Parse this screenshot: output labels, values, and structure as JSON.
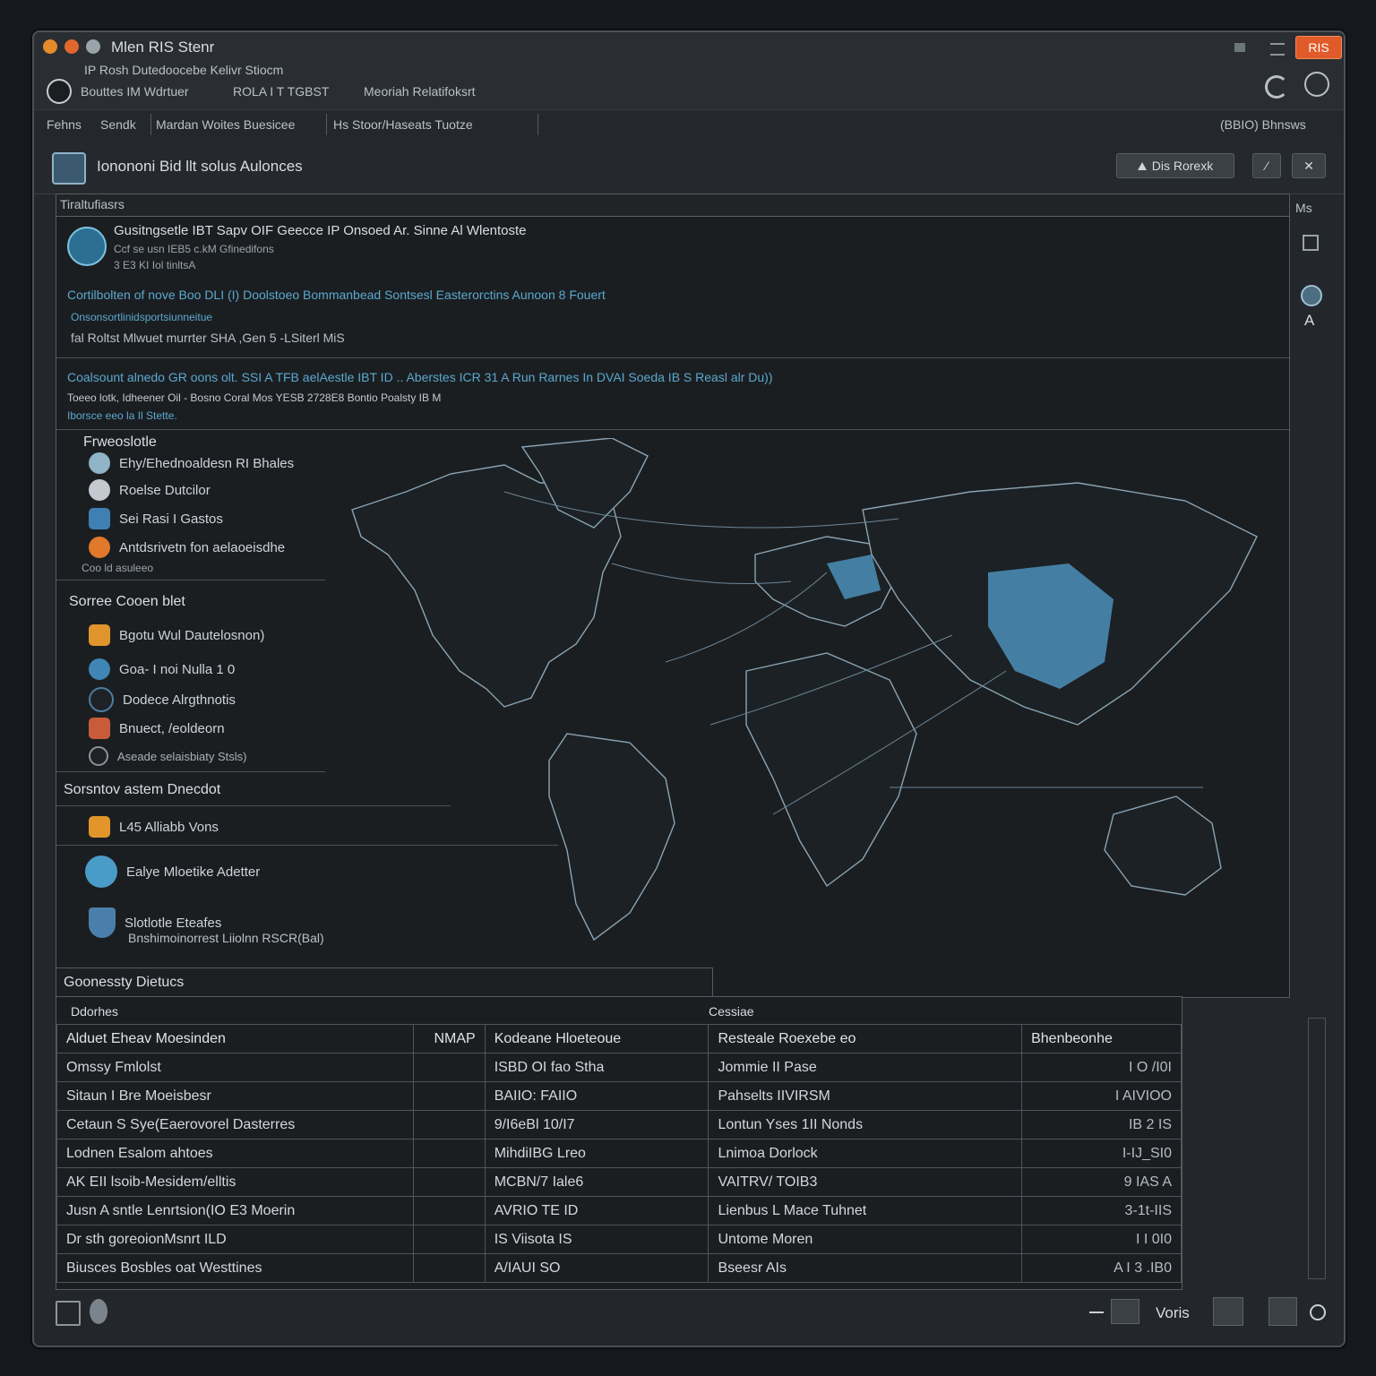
{
  "window": {
    "title": "Mlen RIS Stenr",
    "tray_badge": "RIS",
    "subtitle": "IP Rosh Dutedoocebe Kelivr Stiocm",
    "info_line": "Bouttes IM Wdrtuer",
    "info_mid": "ROLA I T TGBST",
    "info_right": "Meoriah Relatifoksrt"
  },
  "menubar": {
    "items": [
      "Fehns",
      "Sendk",
      "Mardan Woites Buesicee",
      "Hs Stoor/Haseats Tuotze"
    ],
    "right": "(BBIO) Bhnsws"
  },
  "toolbar": {
    "title": "Ionononi Bid llt solus Aulonces",
    "button_primary": "Dis Rorexk",
    "icon_left": "chart-icon",
    "icon_right": "expand-icon"
  },
  "right_rail": {
    "label": "Ms"
  },
  "info_panel": {
    "header": "Tiraltufiasrs",
    "entry_title": "Gusitngsetle IBT Sapv OIF Geecce IP Onsoed Ar. Sinne Al Wlentoste",
    "entry_line2": "Ccf se usn IEB5 c.kM Gfinedifons",
    "entry_line3": "3 E3 KI Iol tinltsA",
    "blue_line": "Cortilbolten of nove Boo DLI (I) Doolstoeo Bommanbead Sontsesl Easterorctins Aunoon 8 Fouert",
    "blue_line2": "Onsonsortlinidsportsiunneitue",
    "detail_line": "fal Roltst Mlwuet murrter SHA ,Gen 5 -LSiterl MiS",
    "summary_blue": "Coalsount alnedo GR oons olt. SSI A TFB aelAestle IBT ID .. Aberstes ICR 31 A Run Rarnes In DVAI Soeda IB S Reasl alr Du))",
    "summary_line2": "Toeeo lotk, Idheener Oil - Bosno Coral Mos YESB 2728E8 Bontio Poalsty IB M",
    "summary_blue2": "Iborsce eeo la Il Stette."
  },
  "prevalence": {
    "title": "Frweoslotle",
    "items": [
      {
        "label": "Ehy/Ehednoaldesn RI Bhales",
        "icon": "tag-icon",
        "color": "#8fb3c7"
      },
      {
        "label": "Roelse Dutcilor",
        "icon": "pin-icon",
        "color": "#c3c9ce"
      },
      {
        "label": "Sei Rasi I Gastos",
        "icon": "device-icon",
        "color": "#3e7fb4"
      },
      {
        "label": "Antdsrivetn fon aelaoeisdhe",
        "icon": "fire-icon",
        "color": "#e2782a"
      }
    ],
    "footer": "Coo ld asuleeo"
  },
  "source": {
    "title": "Sorree Cooen blet",
    "items": [
      {
        "label": "Bgotu Wul Dautelosnon)",
        "icon": "folder-icon",
        "color": "#e0952c"
      },
      {
        "label": "Goa- I noi Nulla 1 0",
        "icon": "globe-icon",
        "color": "#3f86b6"
      },
      {
        "label": "Dodece Alrgthnotis",
        "icon": "refresh-icon",
        "color": "#4b7ea4"
      },
      {
        "label": "Bnuect, /eoldeorn",
        "icon": "doc-icon",
        "color": "#c85c3a"
      },
      {
        "label": "Aseade selaisbiaty Stsls)",
        "icon": "badge-icon",
        "color": "#8b9299"
      }
    ]
  },
  "detection": {
    "title": "Sorsntov astem Dnecdot",
    "items": [
      {
        "label": "L45 Alliabb Vons",
        "icon": "user-icon",
        "color": "#e2952a"
      },
      {
        "label": "Ealye Mloetike Adetter",
        "icon": "globe-icon",
        "color": "#4a9cc8"
      },
      {
        "label": "Slotlotle Eteafes",
        "icon": "shield-icon",
        "color": "#4b7fab"
      }
    ],
    "footnote": "Bnshimoinorrest Liiolnn RSCR(Bal)"
  },
  "table": {
    "section_title": "Goonessty Dietucs",
    "left_header": "Ddorhes",
    "right_header": "Cessiae",
    "columns": [
      "Alduet Eheav Moesinden",
      "NMAP",
      "Kodeane Hloeteoue",
      "Resteale Roexebe eo",
      "Bhenbeonhe"
    ],
    "rows": [
      [
        "Omssy Fmlolst",
        "",
        "ISBD OI fao Stha",
        "Jommie II Pase",
        "I O /I0I"
      ],
      [
        "Sitaun I Bre Moeisbesr",
        "",
        "BAIIO: FAIIO",
        "Pahselts IIVIRSM",
        "I AIVIOO"
      ],
      [
        "Cetaun S Sye(Eaerovorel Dasterres",
        "",
        "9/I6eBl 10/I7",
        "Lontun Yses 1II Nonds",
        "IB 2 IS"
      ],
      [
        "Lodnen Esalom ahtoes",
        "",
        "MihdiIBG Lreo",
        "Lnimoa Dorlock",
        "I-IJ_SI0"
      ],
      [
        "AK EII lsoib-Mesidem/elltis",
        "",
        "MCBN/7 Iale6",
        "VAITRV/ TOIB3",
        "9 IAS A"
      ],
      [
        "Jusn A sntle Lenrtsion(IO E3 Moerin",
        "",
        "AVRIO TE ID",
        "Lienbus L Mace Tuhnet",
        "3-1t-IIS"
      ],
      [
        "Dr sth goreoionMsnrt ILD",
        "",
        "IS Viisota IS",
        "Untome Moren",
        "I I 0I0"
      ],
      [
        "Biusces Bosbles oat Westtines",
        "",
        "A/IAUI SO",
        "Bseesr AIs",
        "A I 3 .IB0"
      ]
    ]
  },
  "statusbar": {
    "label": "Voris",
    "icons": [
      "calendar-icon",
      "settings-icon",
      "network-icon",
      "tools-icon",
      "save-icon",
      "help-icon"
    ]
  },
  "colors": {
    "accent": "#5aa9cf",
    "map_land": "#1a1f23",
    "map_highlight": "#4f97c3",
    "map_lines": "#8aa4b4",
    "badge": "#e05a2a"
  },
  "map": {
    "icon": "world-map-icon"
  }
}
